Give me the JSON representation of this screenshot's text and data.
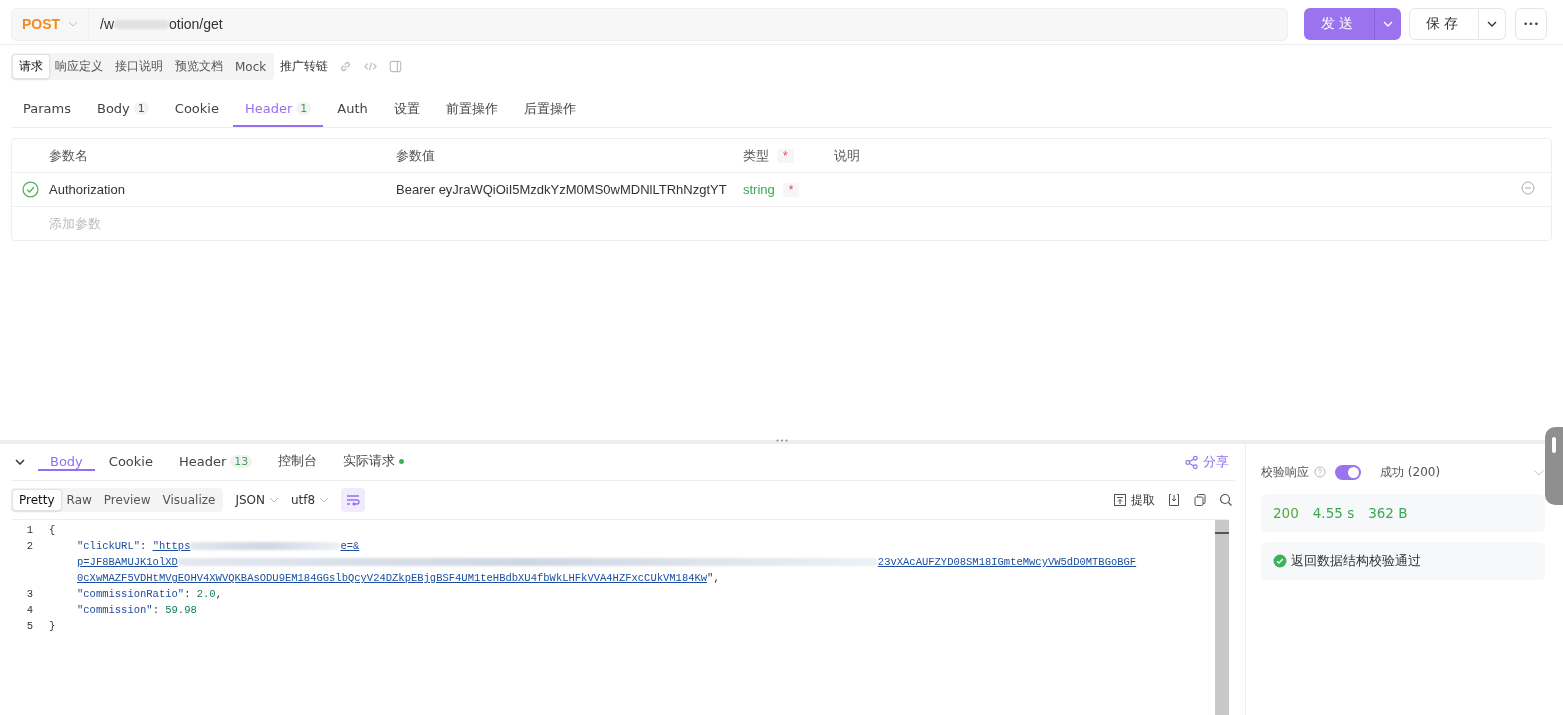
{
  "request_bar": {
    "method": "POST",
    "url_start": "/w",
    "url_end": "otion/get",
    "send_label": "发送",
    "save_label": "保存",
    "more": "•••"
  },
  "mode_tabs": [
    {
      "label": "请求",
      "selected": true
    },
    {
      "label": "响应定义",
      "selected": false
    },
    {
      "label": "接口说明",
      "selected": false
    },
    {
      "label": "预览文档",
      "selected": false
    },
    {
      "label": "Mock",
      "selected": false
    }
  ],
  "promo_link": "推广转链",
  "request_tabs": [
    {
      "label": "Params",
      "selected": false
    },
    {
      "label": "Body",
      "badge": "1",
      "selected": false
    },
    {
      "label": "Cookie",
      "selected": false
    },
    {
      "label": "Header",
      "badge": "1",
      "selected": true
    },
    {
      "label": "Auth",
      "selected": false
    },
    {
      "label": "设置",
      "selected": false
    },
    {
      "label": "前置操作",
      "selected": false
    },
    {
      "label": "后置操作",
      "selected": false
    }
  ],
  "params_table": {
    "columns": [
      {
        "label": "参数名"
      },
      {
        "label": "参数值"
      },
      {
        "label": "类型",
        "required_mark": "*"
      },
      {
        "label": "说明"
      }
    ],
    "rows": [
      {
        "enabled": true,
        "name": "Authorization",
        "value": "Bearer eyJraWQiOiI5MzdkYzM0MS0wMDNlLTRhNzgtYT",
        "type": "string",
        "required_mark": "*"
      }
    ],
    "add_placeholder": "添加参数"
  },
  "response_tabs": [
    {
      "label": "Body",
      "selected": true
    },
    {
      "label": "Cookie",
      "selected": false
    },
    {
      "label": "Header",
      "badge": "13",
      "selected": false
    },
    {
      "label": "控制台",
      "selected": false
    },
    {
      "label": "实际请求",
      "dot": true,
      "selected": false
    }
  ],
  "share_label": "分享",
  "view_tabs": [
    {
      "label": "Pretty",
      "selected": true
    },
    {
      "label": "Raw",
      "selected": false
    },
    {
      "label": "Preview",
      "selected": false
    },
    {
      "label": "Visualize",
      "selected": false
    }
  ],
  "format_select": "JSON",
  "encoding_select": "utf8",
  "wrap_on": true,
  "extract_label": "提取",
  "code_lines": [
    {
      "number": "1",
      "parts": [
        {
          "kind": "punct",
          "text": "{"
        }
      ]
    },
    {
      "number": "2",
      "indent": true,
      "parts": [
        {
          "kind": "key",
          "text": "\"clickURL\""
        },
        {
          "kind": "punct",
          "text": ": "
        },
        {
          "kind": "link",
          "text": "\"https"
        },
        {
          "kind": "redacted"
        },
        {
          "kind": "link",
          "text": "e=&"
        }
      ]
    },
    {
      "indent": true,
      "parts": [
        {
          "kind": "link",
          "text": "p=JF8BAMUJK1olXD"
        },
        {
          "kind": "redacted"
        },
        {
          "kind": "link",
          "text": "23vXAcAUFZYD08SM18IGmteMwcyVW5dD0MTBGoBGF"
        }
      ]
    },
    {
      "indent": true,
      "parts": [
        {
          "kind": "link",
          "text": "0cXwMAZF5VDHtMVgEOHV4XWVQKBAsODU9EM184GGslbQcyV24DZkpEBjgBSF4UM1teHBdbXU4fbWkLHFkVVA4HZFxcCUkVM184Kw"
        },
        {
          "kind": "punct",
          "text": "\","
        }
      ]
    },
    {
      "number": "3",
      "indent": true,
      "parts": [
        {
          "kind": "key",
          "text": "\"commissionRatio\""
        },
        {
          "kind": "punct",
          "text": ": "
        },
        {
          "kind": "number",
          "text": "2.0"
        },
        {
          "kind": "punct",
          "text": ","
        }
      ]
    },
    {
      "number": "4",
      "indent": true,
      "parts": [
        {
          "kind": "key",
          "text": "\"commission\""
        },
        {
          "kind": "punct",
          "text": ": "
        },
        {
          "kind": "number",
          "text": "59.98"
        }
      ]
    },
    {
      "number": "5",
      "parts": [
        {
          "kind": "punct",
          "text": "}"
        }
      ]
    }
  ],
  "validation": {
    "label": "校验响应",
    "on": true,
    "result_select": "成功 (200)",
    "stats": [
      "200",
      "4.55 s",
      "362 B"
    ],
    "passed": true,
    "message": "返回数据结构校验通过"
  }
}
